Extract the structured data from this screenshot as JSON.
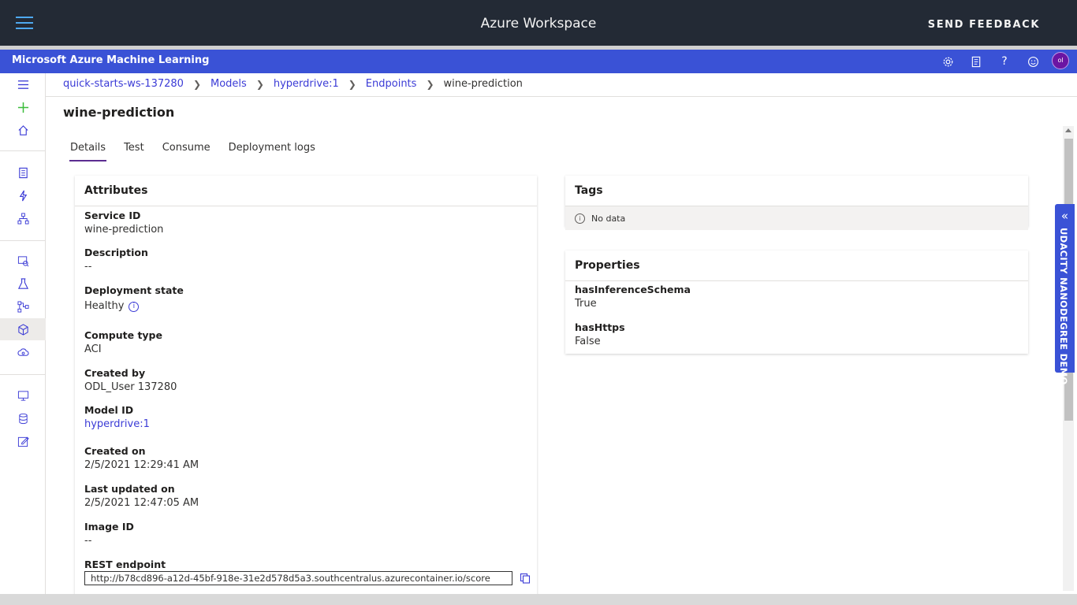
{
  "window": {
    "title": "Azure Workspace",
    "feedback_label": "SEND FEEDBACK"
  },
  "mlbar": {
    "brand": "Microsoft Azure Machine Learning",
    "avatar_initials": "ol"
  },
  "breadcrumb": [
    "quick-starts-ws-137280",
    "Models",
    "hyperdrive:1",
    "Endpoints",
    "wine-prediction"
  ],
  "page": {
    "title": "wine-prediction"
  },
  "tabs": [
    "Details",
    "Test",
    "Consume",
    "Deployment logs"
  ],
  "attributes": {
    "header": "Attributes",
    "service_id_label": "Service ID",
    "service_id": "wine-prediction",
    "description_label": "Description",
    "description": "--",
    "deployment_state_label": "Deployment state",
    "deployment_state": "Healthy",
    "compute_type_label": "Compute type",
    "compute_type": "ACI",
    "created_by_label": "Created by",
    "created_by": "ODL_User 137280",
    "model_id_label": "Model ID",
    "model_id": "hyperdrive:1",
    "created_on_label": "Created on",
    "created_on": "2/5/2021 12:29:41 AM",
    "last_updated_label": "Last updated on",
    "last_updated": "2/5/2021 12:47:05 AM",
    "image_id_label": "Image ID",
    "image_id": "--",
    "rest_endpoint_label": "REST endpoint",
    "rest_endpoint": "http://b78cd896-a12d-45bf-918e-31e2d578d5a3.southcentralus.azurecontainer.io/score"
  },
  "tags": {
    "header": "Tags",
    "empty": "No data"
  },
  "properties": {
    "header": "Properties",
    "has_inference_schema_label": "hasInferenceSchema",
    "has_inference_schema": "True",
    "has_https_label": "hasHttps",
    "has_https": "False"
  },
  "side_panel": {
    "label": "UDACITY NANODEGREE DEMO"
  },
  "colors": {
    "topbar": "#232a35",
    "mlbar": "#3a52d6",
    "link": "#3b3bd6",
    "tab_underline": "#5c2d91"
  }
}
